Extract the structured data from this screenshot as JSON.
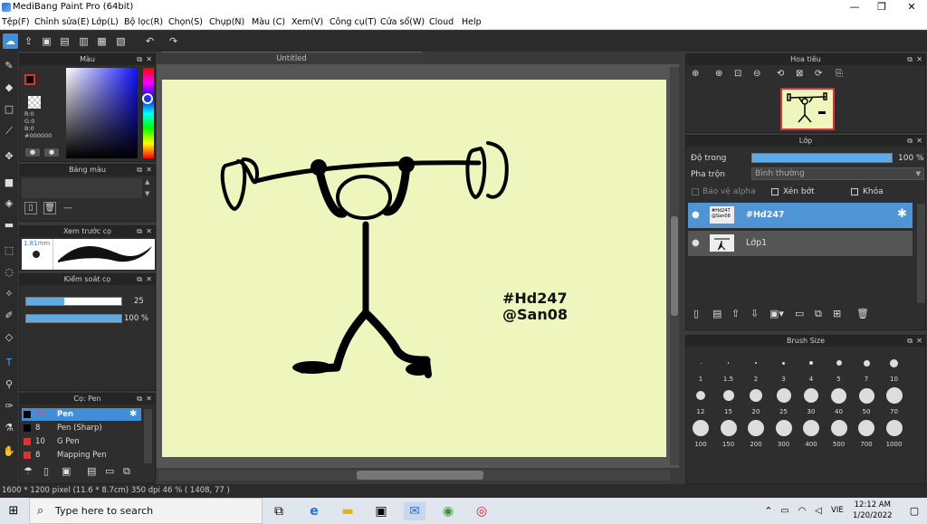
{
  "window": {
    "title": "MediBang Paint Pro (64bit)",
    "minimize": "—",
    "maximize": "❐",
    "close": "✕"
  },
  "menu": [
    "Tệp(F)",
    "Chỉnh sửa(E)",
    "Lớp(L)",
    "Bộ lọc(R)",
    "Chọn(S)",
    "Chụp(N)",
    "Màu (C)",
    "Xem(V)",
    "Công cụ(T)",
    "Cửa sổ(W)",
    "Cloud",
    "Help"
  ],
  "panels": {
    "color": {
      "title": "Màu",
      "r": "R:0",
      "g": "G:0",
      "b": "B:0",
      "hex": "#000000"
    },
    "palette": {
      "title": "Bảng màu",
      "empty": "---"
    },
    "brush_preview": {
      "title": "Xem trước cọ",
      "size": "1.81mm"
    },
    "brush_control": {
      "title": "Kiểm soát cọ",
      "size_value": "25",
      "opacity_value": "100 %",
      "size_fraction": 0.4,
      "opacity_fraction": 1.0
    },
    "brushes": {
      "title": "Cọ: Pen",
      "items": [
        {
          "size": "25",
          "name": "Pen",
          "color": "#000000",
          "selected": true
        },
        {
          "size": "8",
          "name": "Pen (Sharp)",
          "color": "#000000",
          "selected": false
        },
        {
          "size": "10",
          "name": "G Pen",
          "color": "#e03030",
          "selected": false
        },
        {
          "size": "8",
          "name": "Mapping Pen",
          "color": "#e03030",
          "selected": false
        }
      ]
    },
    "navigator": {
      "title": "Hoa tiêu"
    },
    "layer": {
      "title": "Lớp",
      "opacity_label": "Độ trong",
      "opacity_value": "100 %",
      "blend_label": "Pha trộn",
      "blend_value": "Bình thường",
      "protect_alpha": "Bảo vệ alpha",
      "clipping": "Xén bớt",
      "lock": "Khóa",
      "layers": [
        {
          "name": "#Hd247",
          "selected": true
        },
        {
          "name": "Lớp1",
          "selected": false
        }
      ]
    },
    "brush_size": {
      "title": "Brush Size",
      "sizes": [
        "1",
        "1.5",
        "2",
        "3",
        "4",
        "5",
        "7",
        "10",
        "12",
        "15",
        "20",
        "25",
        "30",
        "40",
        "50",
        "70",
        "100",
        "150",
        "200",
        "300",
        "400",
        "500",
        "700",
        "1000"
      ]
    }
  },
  "canvas": {
    "tab": "Untitled",
    "text_line1": "#Hd247",
    "text_line2": "@San08"
  },
  "status": {
    "text": "1600 * 1200 pixel   (11.6 * 8.7cm)   350 dpi   46 %   ( 1408, 77 )"
  },
  "taskbar": {
    "search_placeholder": "Type here to search",
    "time": "12:12 AM",
    "date": "1/20/2022",
    "lang": "VIE"
  }
}
